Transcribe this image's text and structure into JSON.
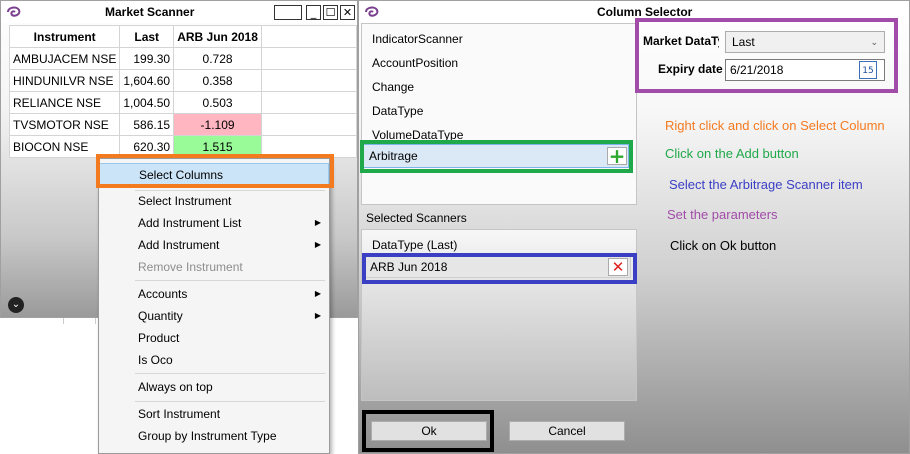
{
  "market_scanner": {
    "title": "Market Scanner",
    "columns": [
      "Instrument",
      "Last",
      "ARB Jun 2018"
    ],
    "rows": [
      {
        "instrument": "AMBUJACEM NSE",
        "last": "199.30",
        "arb": "0.728",
        "status": "neutral"
      },
      {
        "instrument": "HINDUNILVR NSE",
        "last": "1,604.60",
        "arb": "0.358",
        "status": "neutral"
      },
      {
        "instrument": "RELIANCE NSE",
        "last": "1,004.50",
        "arb": "0.503",
        "status": "neutral"
      },
      {
        "instrument": "TVSMOTOR NSE",
        "last": "586.15",
        "arb": "-1.109",
        "status": "negative"
      },
      {
        "instrument": "BIOCON NSE",
        "last": "620.30",
        "arb": "1.515",
        "status": "positive"
      }
    ],
    "window_buttons": {
      "minimize": "_",
      "maximize": "☐",
      "close": "✕"
    }
  },
  "context_menu": {
    "items": [
      {
        "label": "Select Columns",
        "enabled": true,
        "submenu": false
      },
      {
        "label": "Select Instrument",
        "enabled": true,
        "submenu": false
      },
      {
        "label": "Add Instrument List",
        "enabled": true,
        "submenu": true
      },
      {
        "label": "Add Instrument",
        "enabled": true,
        "submenu": true
      },
      {
        "label": "Remove  Instrument",
        "enabled": false,
        "submenu": false
      },
      {
        "label": "Accounts",
        "enabled": true,
        "submenu": true
      },
      {
        "label": "Quantity",
        "enabled": true,
        "submenu": true
      },
      {
        "label": "Product",
        "enabled": true,
        "submenu": false
      },
      {
        "label": "Is Oco",
        "enabled": true,
        "submenu": false
      },
      {
        "label": "Always on top",
        "enabled": true,
        "submenu": false
      },
      {
        "label": "Sort Instrument",
        "enabled": true,
        "submenu": false
      },
      {
        "label": "Group by Instrument Type",
        "enabled": true,
        "submenu": false
      }
    ]
  },
  "column_selector": {
    "title": "Column Selector",
    "available_scanners": [
      "IndicatorScanner",
      "AccountPosition",
      "Change",
      "DataType",
      "VolumeDataType",
      "Arbitrage"
    ],
    "selected_label": "Selected Scanners",
    "selected_scanners": [
      "DataType (Last)",
      "ARB Jun 2018"
    ],
    "params": {
      "market_data_label": "Market DataTy",
      "market_data_value": "Last",
      "expiry_label": "Expiry date",
      "expiry_value": "6/21/2018",
      "calendar_day": "15"
    },
    "ok_label": "Ok",
    "cancel_label": "Cancel"
  },
  "instructions": {
    "step1": "Right click and click on Select Column",
    "step2": "Click on the Add button",
    "step3": "Select the Arbitrage Scanner item",
    "step4": "Set the parameters",
    "step5": "Click on Ok button"
  },
  "colors": {
    "orange": "#f47a20",
    "green": "#1fa94a",
    "blue": "#3a3fc4",
    "purple": "#a04ca8",
    "black": "#000000",
    "negative_cell": "#ffb6c1",
    "positive_cell": "#98fb98"
  }
}
